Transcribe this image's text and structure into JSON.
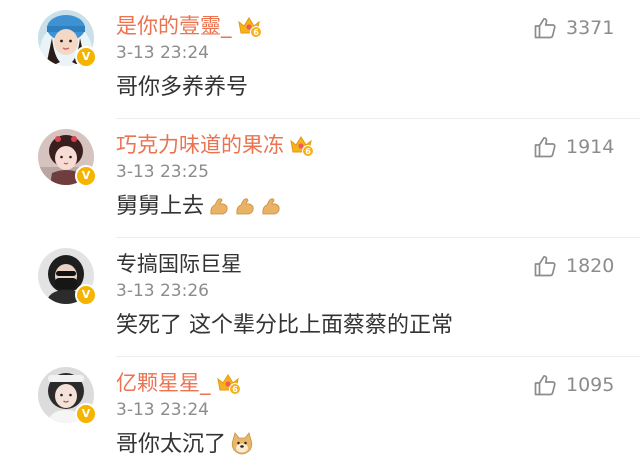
{
  "colors": {
    "username": "#eb7350",
    "plain_username": "#333333",
    "meta": "#8c8c8c",
    "verified_badge": "#f5b400",
    "divider": "#ececec"
  },
  "comments": [
    {
      "username": "是你的壹靈_",
      "username_style": "orange",
      "member_icon": "crown-level-icon",
      "member_level": "6",
      "timestamp": "3-13 23:24",
      "text": "哥你多养养号",
      "emojis": [],
      "likes": "3371",
      "verified": true
    },
    {
      "username": "巧克力味道的果冻",
      "username_style": "orange",
      "member_icon": "crown-level-icon",
      "member_level": "6",
      "timestamp": "3-13 23:25",
      "text": "舅舅上去",
      "emojis": [
        "flexed-biceps-icon",
        "flexed-biceps-icon",
        "flexed-biceps-icon"
      ],
      "likes": "1914",
      "verified": true
    },
    {
      "username": "专搞国际巨星",
      "username_style": "plain",
      "timestamp": "3-13 23:26",
      "text": "笑死了 这个辈分比上面蔡蔡的正常",
      "emojis": [],
      "likes": "1820",
      "verified": true
    },
    {
      "username": "亿颗星星_",
      "username_style": "orange",
      "member_icon": "crown-level-icon",
      "member_level": "6",
      "timestamp": "3-13 23:24",
      "text": "哥你太沉了",
      "emojis": [
        "doge-icon"
      ],
      "likes": "1095",
      "verified": true
    }
  ]
}
